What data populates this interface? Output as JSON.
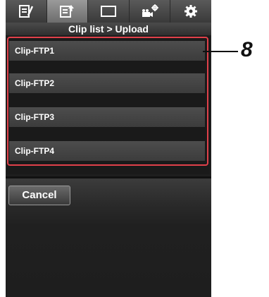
{
  "tabs": [
    {
      "icon": "note-icon",
      "active": false
    },
    {
      "icon": "clip-upload-icon",
      "active": true
    },
    {
      "icon": "display-icon",
      "active": false
    },
    {
      "icon": "camera-settings-icon",
      "active": false
    },
    {
      "icon": "gear-icon",
      "active": false
    }
  ],
  "header": {
    "title": "Clip list > Upload"
  },
  "clips": [
    {
      "label": "Clip-FTP1"
    },
    {
      "label": "Clip-FTP2"
    },
    {
      "label": "Clip-FTP3"
    },
    {
      "label": "Clip-FTP4"
    }
  ],
  "actions": {
    "cancel_label": "Cancel"
  },
  "callout": {
    "number": "8"
  },
  "colors": {
    "highlight": "#e0404a",
    "background": "#1e1e1e"
  }
}
